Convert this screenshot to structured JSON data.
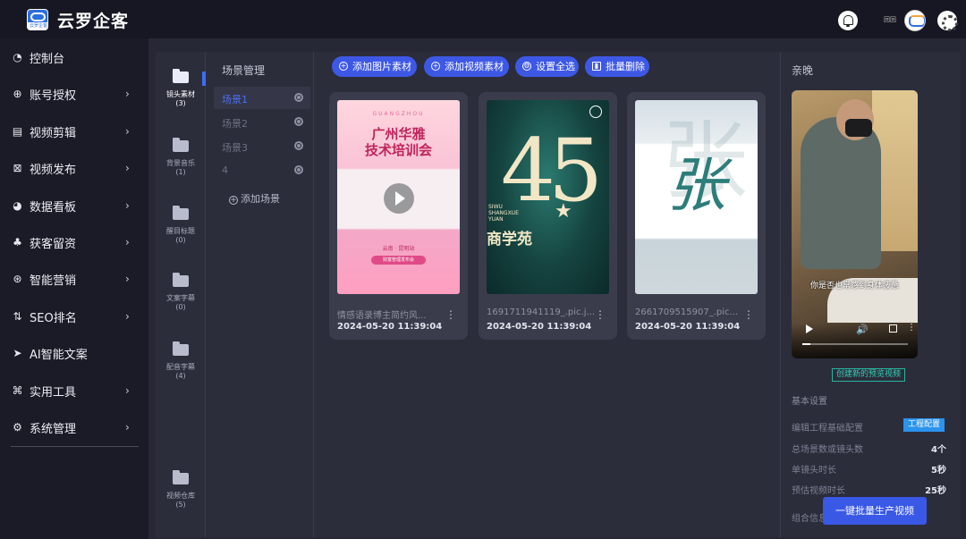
{
  "app": {
    "title": "云罗企客",
    "logo_tag": "云罗企客"
  },
  "header": {
    "user_name": "回回",
    "bell": "bell-icon"
  },
  "sidebar": {
    "items": [
      {
        "label": "控制台",
        "icon": "gauge-icon",
        "glyph": "◔",
        "chevron": false
      },
      {
        "label": "账号授权",
        "icon": "crosshair-icon",
        "glyph": "⊕",
        "chevron": true
      },
      {
        "label": "视频剪辑",
        "icon": "film-icon",
        "glyph": "▤",
        "chevron": true
      },
      {
        "label": "视频发布",
        "icon": "grid-icon",
        "glyph": "⊠",
        "chevron": true
      },
      {
        "label": "数据看板",
        "icon": "pie-chart-icon",
        "glyph": "◕",
        "chevron": true
      },
      {
        "label": "获客留资",
        "icon": "org-chart-icon",
        "glyph": "♣",
        "chevron": true
      },
      {
        "label": "智能营销",
        "icon": "globe-icon",
        "glyph": "⊛",
        "chevron": true
      },
      {
        "label": "SEO排名",
        "icon": "sort-icon",
        "glyph": "⇅",
        "chevron": true
      },
      {
        "label": "AI智能文案",
        "icon": "send-icon",
        "glyph": "➤",
        "chevron": false
      },
      {
        "label": "实用工具",
        "icon": "command-icon",
        "glyph": "⌘",
        "chevron": true
      },
      {
        "label": "系统管理",
        "icon": "gear-icon",
        "glyph": "⚙",
        "chevron": true
      }
    ],
    "chevron_glyph": "›"
  },
  "categories": [
    {
      "label": "镜头素材",
      "count": "(3)",
      "active": true
    },
    {
      "label": "背景音乐",
      "count": "(1)",
      "active": false
    },
    {
      "label": "醒目标题",
      "count": "(0)",
      "active": false
    },
    {
      "label": "文案字幕",
      "count": "(0)",
      "active": false
    },
    {
      "label": "配音字幕",
      "count": "(4)",
      "active": false
    },
    {
      "label": "视频仓库",
      "count": "(5)",
      "active": false
    }
  ],
  "scenes": {
    "title": "场景管理",
    "items": [
      "场景1",
      "场景2",
      "场景3",
      "4"
    ],
    "active_index": 0,
    "add_label": "添加场景"
  },
  "toolbar": {
    "add_image": "添加图片素材",
    "add_video": "添加视频素材",
    "select_all": "设置全选",
    "batch_delete": "批量删除"
  },
  "materials": [
    {
      "name": "情感语录博主简约风...",
      "date": "2024-05-20 11:39:04",
      "thumb": {
        "en_line": "GUANGZHOU",
        "headline_1": "广州华雅",
        "headline_2": "技术培训会",
        "sub": "云南 · 昆明站",
        "pill": "财富管理发布会"
      }
    },
    {
      "name": "1691711941119_.pic.j...",
      "date": "2024-05-20 11:39:04",
      "thumb": {
        "number": "45",
        "latin": "SIWU\nSHANGXUE\nYUAN",
        "cn": "商学苑"
      }
    },
    {
      "name": "2661709515907_.pic...",
      "date": "2024-05-20 11:39:04",
      "thumb": {
        "char": "张"
      }
    }
  ],
  "more_glyph": "⋮",
  "preview": {
    "title": "亲晚",
    "caption": "你是否也常感到身体疲惫",
    "progress": 0.08,
    "create_label": "创建新的预览视频",
    "section": "基本设置",
    "config_label": "编辑工程基础配置",
    "config_button": "工程配置",
    "rows": [
      {
        "label": "总场景数或镜头数",
        "value": "4个"
      },
      {
        "label": "单镜头时长",
        "value": "5秒"
      },
      {
        "label": "预估视频时长",
        "value": "25秒"
      }
    ],
    "combo_label": "组合信息",
    "generate_button": "一键批量生产视频"
  }
}
